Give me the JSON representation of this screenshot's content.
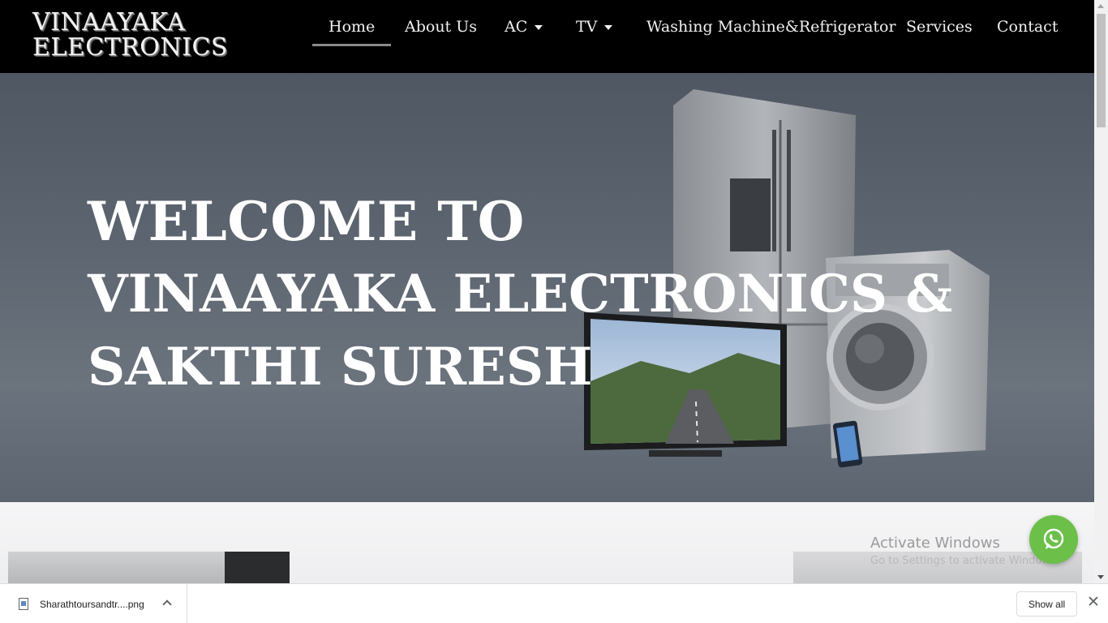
{
  "brand": {
    "line1": "VINAAYAKA",
    "line2": "ELECTRONICS"
  },
  "nav": {
    "items": [
      {
        "label": "Home",
        "active": true,
        "dropdown": false
      },
      {
        "label": "About Us",
        "active": false,
        "dropdown": false
      },
      {
        "label": "AC",
        "active": false,
        "dropdown": true
      },
      {
        "label": "TV",
        "active": false,
        "dropdown": true
      },
      {
        "label": "Washing Machine&Refrigerator",
        "active": false,
        "dropdown": false
      },
      {
        "label": "Services",
        "active": false,
        "dropdown": false
      },
      {
        "label": "Contact",
        "active": false,
        "dropdown": false
      }
    ]
  },
  "hero": {
    "line1": "WELCOME TO",
    "line2": "VINAAYAKA ELECTRONICS &",
    "line3": "SAKTHI SURESH",
    "image": "appliances-fridge-tv-washing-machine"
  },
  "overlay": {
    "activate_title": "Activate Windows",
    "activate_sub": "Go to Settings to activate Windows."
  },
  "whatsapp": {
    "icon": "whatsapp-icon",
    "color": "#6cc04a"
  },
  "download_bar": {
    "file_name": "Sharathtoursandtr....png",
    "show_all": "Show all",
    "close": "✕"
  },
  "colors": {
    "header_bg": "#000000",
    "hero_bg": "#5d6570",
    "nav_text": "#f0f0f0"
  }
}
